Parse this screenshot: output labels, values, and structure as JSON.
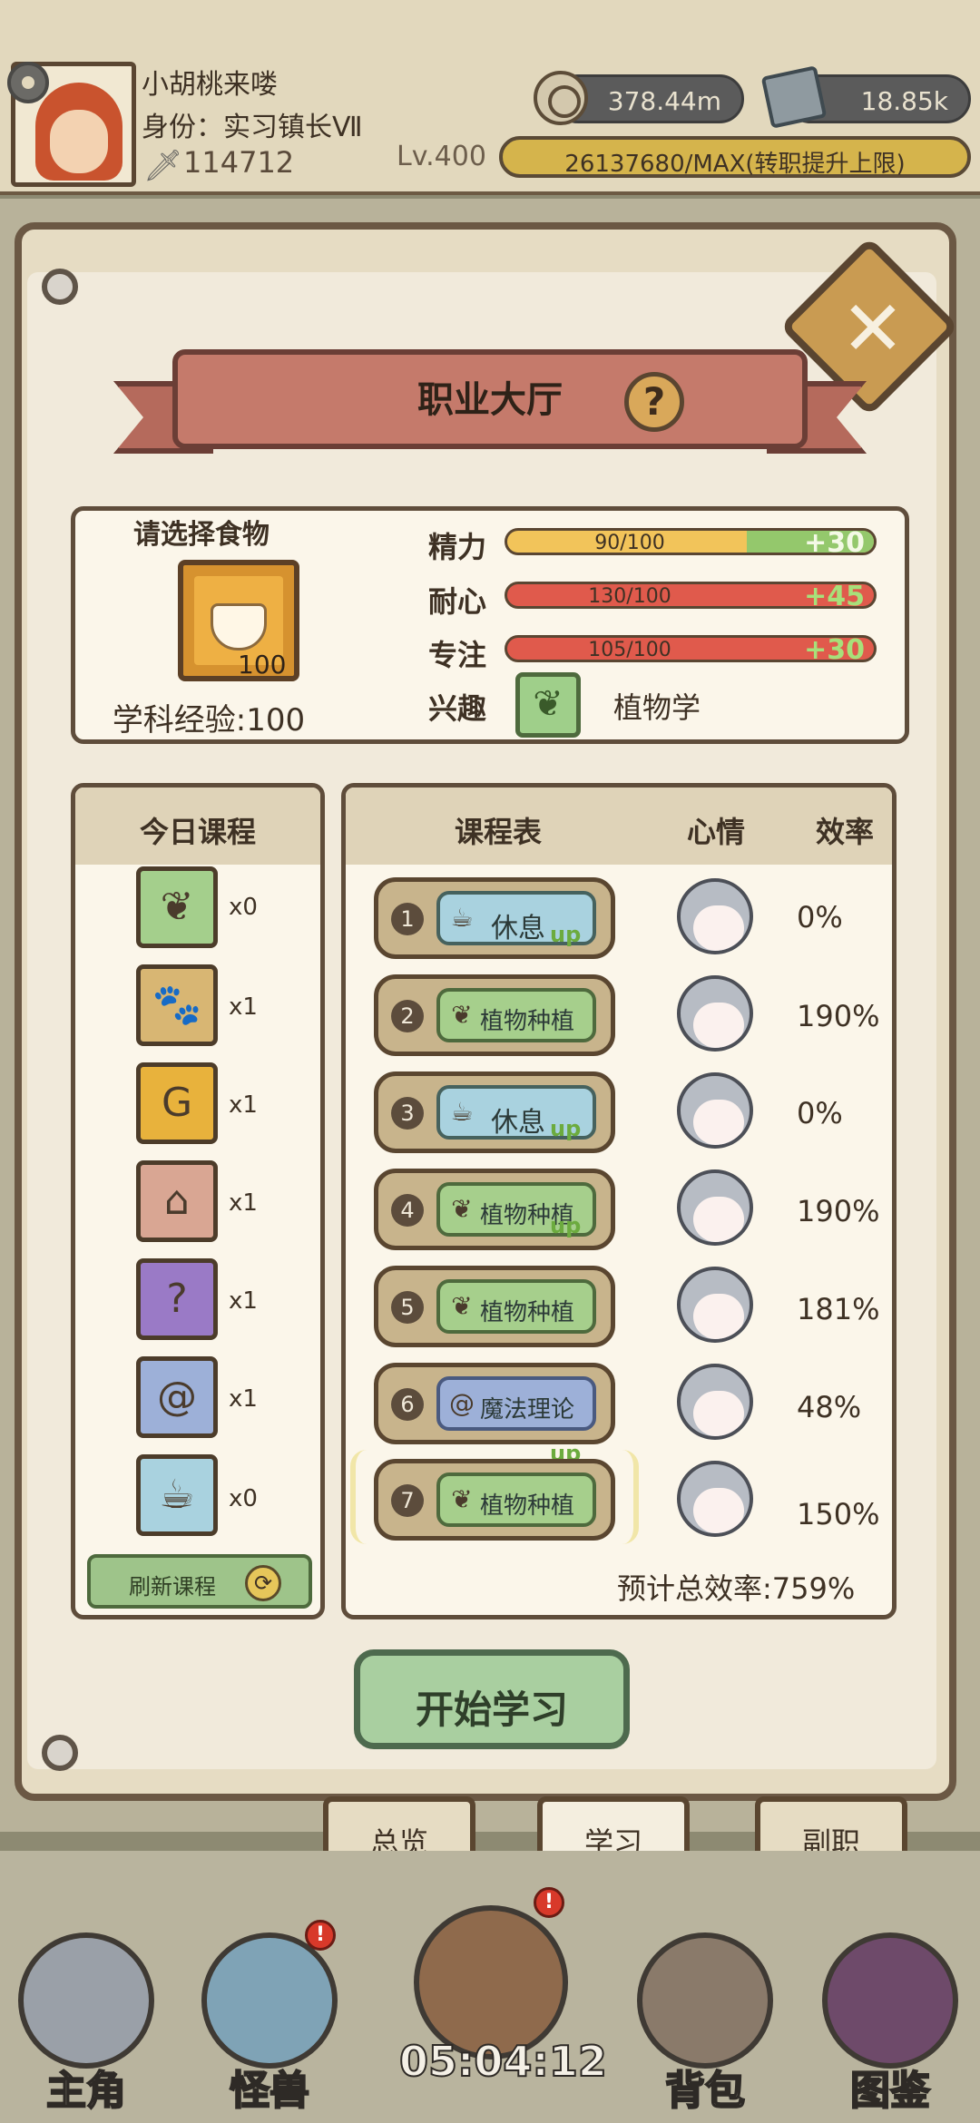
{
  "player": {
    "name": "小胡桃来喽",
    "identity": "身份：实习镇长Ⅶ",
    "power": "114712",
    "level": "Lv.400",
    "exp": "26137680/MAX(转职提升上限)"
  },
  "resources": {
    "coins": "378.44m",
    "ore": "18.85k"
  },
  "panel": {
    "title": "职业大厅",
    "food_label": "请选择食物",
    "food_count": "100",
    "subject_exp": "学科经验:100"
  },
  "stats": [
    {
      "label": "精力",
      "value": "90/100",
      "bonus": "+30",
      "fraction": 0.9
    },
    {
      "label": "耐心",
      "value": "130/100",
      "bonus": "+45",
      "fraction": 1.0
    },
    {
      "label": "专注",
      "value": "105/100",
      "bonus": "+30",
      "fraction": 1.0
    }
  ],
  "interest": {
    "label": "兴趣",
    "name": "植物学"
  },
  "today": {
    "title": "今日课程",
    "courses": [
      {
        "icon": "leaf-icon",
        "count": "x0",
        "color": "#a4cf8c"
      },
      {
        "icon": "paw-icon",
        "count": "x1",
        "color": "#d8b673"
      },
      {
        "icon": "money-bag-icon",
        "count": "x1",
        "color": "#e8b23c"
      },
      {
        "icon": "house-icon",
        "count": "x1",
        "color": "#d9a693"
      },
      {
        "icon": "potion-icon",
        "count": "x1",
        "color": "#9a7ac6"
      },
      {
        "icon": "magic-book-icon",
        "count": "x1",
        "color": "#9db0d8"
      },
      {
        "icon": "cup-icon",
        "count": "x0",
        "color": "#a9d2df"
      }
    ],
    "refresh": "刷新课程"
  },
  "schedule": {
    "headers": {
      "course": "课程表",
      "mood": "心情",
      "efficiency": "效率"
    },
    "rows": [
      {
        "num": "1",
        "label": "休息",
        "type": "rest",
        "up": false,
        "mood": "sleepy",
        "efficiency": "0%"
      },
      {
        "num": "2",
        "label": "植物种植",
        "type": "plant",
        "up": true,
        "mood": "happy",
        "efficiency": "190%"
      },
      {
        "num": "3",
        "label": "休息",
        "type": "rest",
        "up": false,
        "mood": "crying",
        "efficiency": "0%"
      },
      {
        "num": "4",
        "label": "植物种植",
        "type": "plant",
        "up": true,
        "mood": "happy",
        "efficiency": "190%"
      },
      {
        "num": "5",
        "label": "植物种植",
        "type": "plant",
        "up": true,
        "mood": "happy",
        "efficiency": "181%"
      },
      {
        "num": "6",
        "label": "魔法理论",
        "type": "magic",
        "up": false,
        "mood": "sleepy",
        "efficiency": "48%"
      },
      {
        "num": "7",
        "label": "植物种植",
        "type": "plant",
        "up": true,
        "mood": "happy",
        "efficiency": "150%"
      }
    ],
    "up_label": "up",
    "total": "预计总效率:759%"
  },
  "start_button": "开始学习",
  "tabs": [
    "总览",
    "学习",
    "副职"
  ],
  "nav": [
    "主角",
    "怪兽",
    "背包",
    "图鉴"
  ],
  "timer": "05:04:12",
  "colors": {
    "rest": "#a9d2df",
    "plant": "#a6cf8c",
    "magic": "#9db0d8"
  }
}
